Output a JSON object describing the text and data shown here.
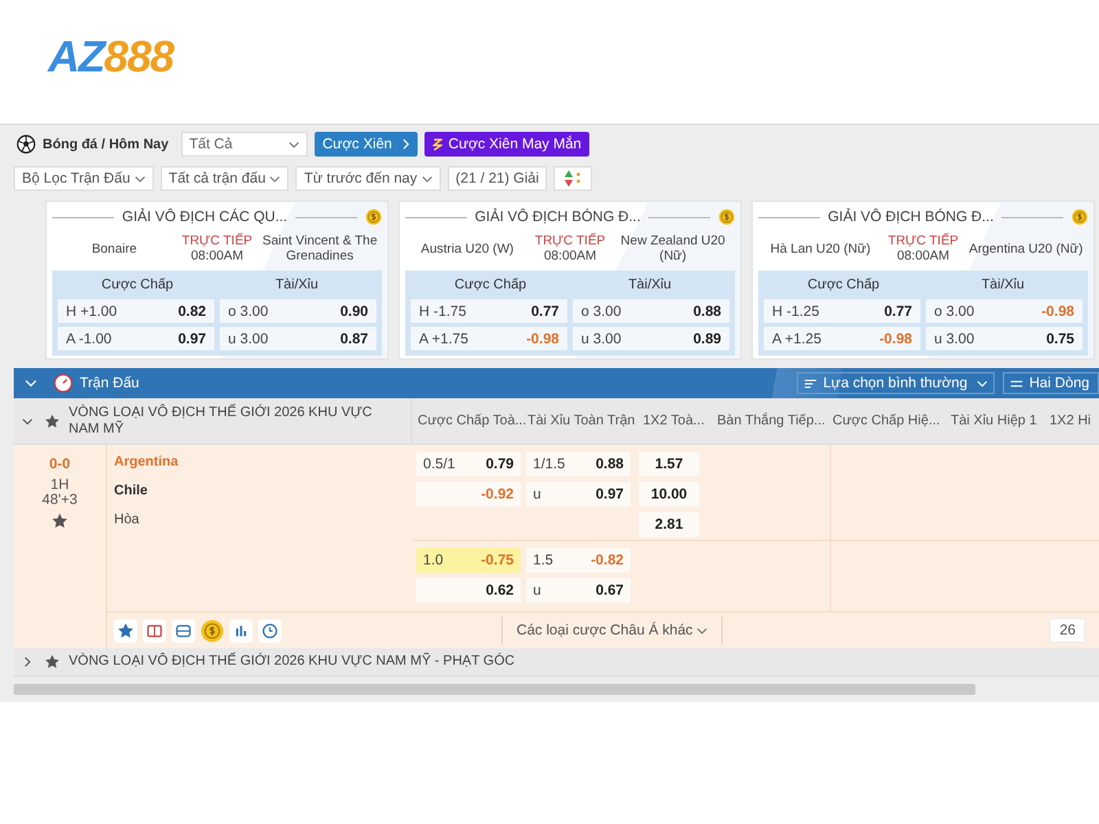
{
  "logo": {
    "text_a": "AZ",
    "text_b": "888"
  },
  "toolbar": {
    "breadcrumb": "Bóng đá / Hôm Nay",
    "filter_select": "Tất Cả",
    "parlay_button": "Cược Xiên",
    "lucky_parlay_button": "Cược Xiên May Mắn"
  },
  "filters": [
    "Bộ Lọc Trận Đấu",
    "Tất cả trận đấu",
    "Từ trước đến nay"
  ],
  "league_count": "(21 / 21) Giải",
  "cards": [
    {
      "league": "GIẢI VÔ ĐỊCH CÁC QU...",
      "home": "Bonaire",
      "away": "Saint Vincent & The Grenadines",
      "status": "TRỰC TIẾP",
      "time": "08:00AM",
      "handicap_label": "Cược Chấp",
      "ou_label": "Tài/Xỉu",
      "rows": [
        {
          "hcap": "H +1.00",
          "hcap_odds": "0.82",
          "hcap_negative": false,
          "ou": "o 3.00",
          "ou_odds": "0.90",
          "ou_negative": false
        },
        {
          "hcap": "A -1.00",
          "hcap_odds": "0.97",
          "hcap_negative": false,
          "ou": "u 3.00",
          "ou_odds": "0.87",
          "ou_negative": false
        }
      ]
    },
    {
      "league": "GIẢI VÔ ĐỊCH BÓNG Đ...",
      "home": "Austria U20 (W)",
      "away": "New Zealand U20 (Nữ)",
      "status": "TRỰC TIẾP",
      "time": "08:00AM",
      "handicap_label": "Cược Chấp",
      "ou_label": "Tài/Xỉu",
      "rows": [
        {
          "hcap": "H -1.75",
          "hcap_odds": "0.77",
          "hcap_negative": false,
          "ou": "o 3.00",
          "ou_odds": "0.88",
          "ou_negative": false
        },
        {
          "hcap": "A +1.75",
          "hcap_odds": "-0.98",
          "hcap_negative": true,
          "ou": "u 3.00",
          "ou_odds": "0.89",
          "ou_negative": false
        }
      ]
    },
    {
      "league": "GIẢI VÔ ĐỊCH BÓNG Đ...",
      "home": "Hà Lan U20 (Nữ)",
      "away": "Argentina U20 (Nữ)",
      "status": "TRỰC TIẾP",
      "time": "08:00AM",
      "handicap_label": "Cược Chấp",
      "ou_label": "Tài/Xỉu",
      "rows": [
        {
          "hcap": "H -1.25",
          "hcap_odds": "0.77",
          "hcap_negative": false,
          "ou": "o 3.00",
          "ou_odds": "-0.98",
          "ou_negative": true
        },
        {
          "hcap": "A +1.25",
          "hcap_odds": "-0.98",
          "hcap_negative": true,
          "ou": "u 3.00",
          "ou_odds": "0.75",
          "ou_negative": false
        }
      ]
    }
  ],
  "section": {
    "title": "Trận Đấu",
    "expanded": true,
    "view_select": "Lựa chọn bình thường",
    "rows_select": "Hai Dòng"
  },
  "columns": [
    "Cược Chấp Toà...",
    "Tài Xỉu Toàn Trận",
    "1X2 Toà...",
    "Bàn Thắng Tiếp...",
    "Cược Chấp Hiệ...",
    "Tài Xỉu Hiệp 1",
    "1X2 Hi"
  ],
  "leagues": [
    {
      "name": "VÒNG LOẠI VÔ ĐỊCH THẾ GIỚI 2026 KHU VỰC NAM MỸ",
      "expanded": true,
      "match": {
        "score": "0-0",
        "period": "1H",
        "minute": "48'+3",
        "teams": [
          {
            "name": "Argentina",
            "favorite": true
          },
          {
            "name": "Chile",
            "favorite": false
          },
          {
            "name": "Hòa",
            "favorite": false
          }
        ],
        "lines": [
          {
            "handicap": [
              {
                "line": "0.5/1",
                "odds": "0.79",
                "negative": false,
                "highlighted": false
              },
              {
                "odds": "-0.92",
                "negative": true,
                "highlighted": false
              }
            ],
            "over_under": [
              {
                "line": "1/1.5",
                "odds": "0.88",
                "negative": false
              },
              {
                "line": "u",
                "odds": "0.97",
                "negative": false
              }
            ],
            "x12": [
              "1.57",
              "10.00",
              "2.81"
            ]
          },
          {
            "handicap": [
              {
                "line": "1.0",
                "odds": "-0.75",
                "negative": true,
                "highlighted": true
              },
              {
                "odds": "0.62",
                "negative": false,
                "highlighted": false
              }
            ],
            "over_under": [
              {
                "line": "1.5",
                "odds": "-0.82",
                "negative": true
              },
              {
                "line": "u",
                "odds": "0.67",
                "negative": false
              }
            ]
          }
        ],
        "more_bets": "Các loại cược Châu Á khác",
        "count": "26"
      }
    },
    {
      "name": "VÒNG LOẠI VÔ ĐỊCH THẾ GIỚI 2026 KHU VỰC NAM MỸ - PHẠT GÓC",
      "expanded": false
    }
  ]
}
